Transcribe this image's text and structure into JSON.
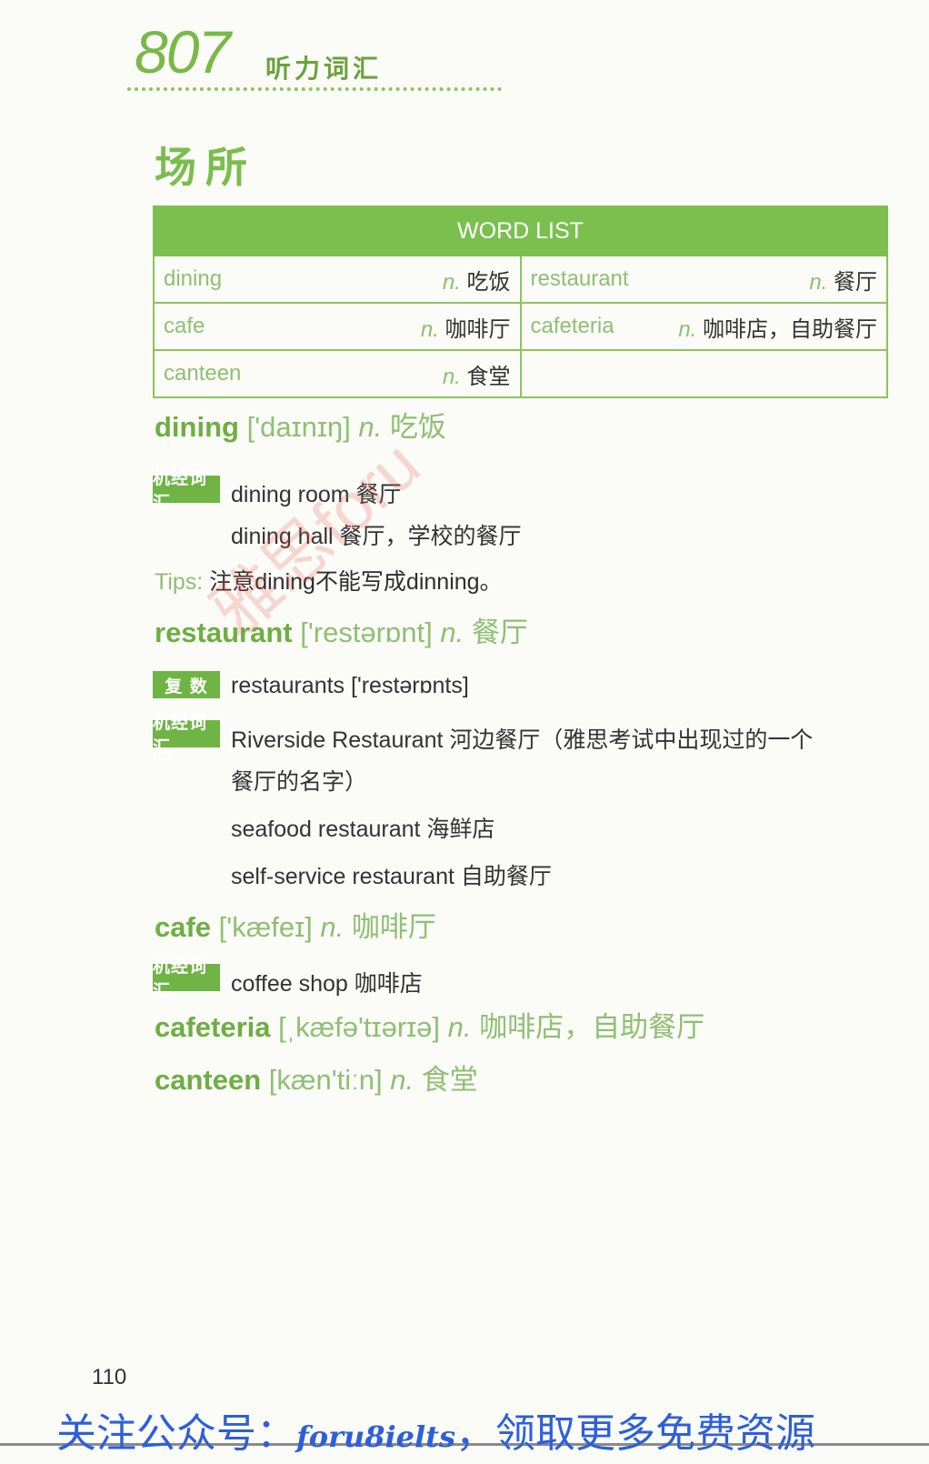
{
  "header": {
    "brand_number": "807",
    "brand_text": "听力词汇"
  },
  "section_title": "场所",
  "word_list": {
    "title": "WORD LIST",
    "rows": [
      [
        {
          "word": "dining",
          "pos": "n.",
          "meaning": "吃饭"
        },
        {
          "word": "restaurant",
          "pos": "n.",
          "meaning": "餐厅"
        }
      ],
      [
        {
          "word": "cafe",
          "pos": "n.",
          "meaning": "咖啡厅"
        },
        {
          "word": "cafeteria",
          "pos": "n.",
          "meaning": "咖啡店，自助餐厅"
        }
      ],
      [
        {
          "word": "canteen",
          "pos": "n.",
          "meaning": "食堂"
        },
        {
          "word": "",
          "pos": "",
          "meaning": ""
        }
      ]
    ]
  },
  "tags": {
    "jijing": "机经词汇",
    "fushu": "复 数"
  },
  "entries": {
    "dining": {
      "word": "dining",
      "phon": "['daɪnɪŋ]",
      "pos": "n.",
      "meaning": "吃饭",
      "ex1": "dining room 餐厅",
      "ex2": "dining hall 餐厅，学校的餐厅"
    },
    "tips": {
      "label": "Tips:",
      "text": "注意dining不能写成dinning。"
    },
    "restaurant": {
      "word": "restaurant",
      "phon": "['restərɒnt]",
      "pos": "n.",
      "meaning": "餐厅",
      "plural": "restaurants ['restərɒnts]",
      "ex1": "Riverside Restaurant 河边餐厅（雅思考试中出现过的一个",
      "ex1b": "餐厅的名字）",
      "ex2": "seafood restaurant 海鲜店",
      "ex3": "self-service restaurant 自助餐厅"
    },
    "cafe": {
      "word": "cafe",
      "phon": "['kæfeɪ]",
      "pos": "n.",
      "meaning": "咖啡厅",
      "ex1": "coffee shop 咖啡店"
    },
    "cafeteria": {
      "word": "cafeteria",
      "phon": "[ˌkæfə'tɪərɪə]",
      "pos": "n.",
      "meaning": "咖啡店，自助餐厅"
    },
    "canteen": {
      "word": "canteen",
      "phon": "[kæn'tiːn]",
      "pos": "n.",
      "meaning": "食堂"
    }
  },
  "page_number": "110",
  "watermark": "雅思foru",
  "footer": {
    "pre": "关注公众号：",
    "account": "foru8ielts",
    "post": "，领取更多免费资源"
  }
}
